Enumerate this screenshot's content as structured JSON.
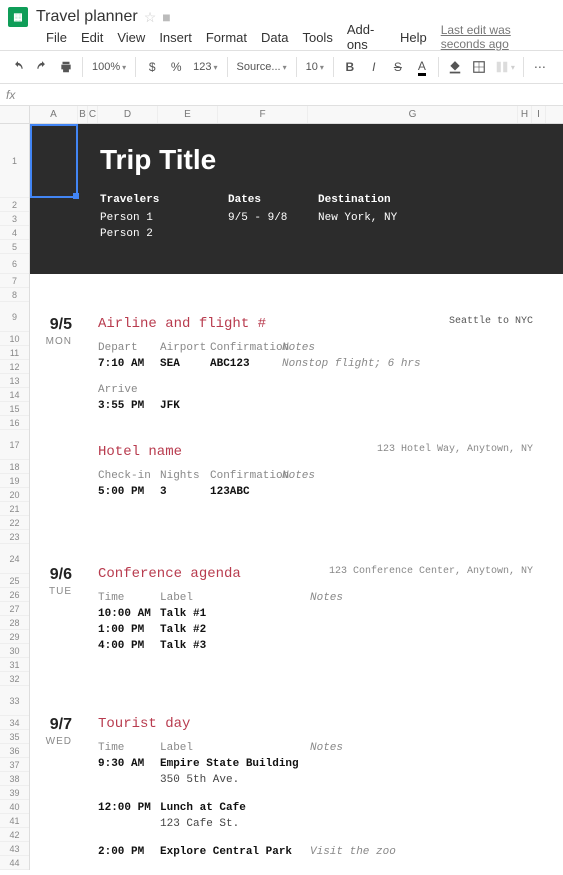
{
  "doc": {
    "title": "Travel planner",
    "last_edit": "Last edit was seconds ago"
  },
  "menu": {
    "file": "File",
    "edit": "Edit",
    "view": "View",
    "insert": "Insert",
    "format": "Format",
    "data": "Data",
    "tools": "Tools",
    "addons": "Add-ons",
    "help": "Help"
  },
  "toolbar": {
    "zoom": "100%",
    "currency": "$",
    "percent": "%",
    "dec": "123",
    "font": "Source...",
    "size": "10"
  },
  "cols": {
    "A": "A",
    "B": "B",
    "C": "C",
    "D": "D",
    "E": "E",
    "F": "F",
    "G": "G",
    "H": "H",
    "I": "I"
  },
  "hero": {
    "title": "Trip Title",
    "travelers_lbl": "Travelers",
    "traveler1": "Person 1",
    "traveler2": "Person 2",
    "dates_lbl": "Dates",
    "dates_val": "9/5 - 9/8",
    "dest_lbl": "Destination",
    "dest_val": "New York, NY"
  },
  "day1": {
    "date": "9/5",
    "dow": "MON",
    "flight": {
      "title": "Airline and flight #",
      "loc": "Seattle to NYC",
      "hdr_depart": "Depart",
      "hdr_airport": "Airport",
      "hdr_conf": "Confirmation",
      "hdr_notes": "Notes",
      "dep_time": "7:10 AM",
      "dep_air": "SEA",
      "conf": "ABC123",
      "notes": "Nonstop flight; 6 hrs",
      "hdr_arrive": "Arrive",
      "arr_time": "3:55 PM",
      "arr_air": "JFK"
    },
    "hotel": {
      "title": "Hotel name",
      "loc": "123 Hotel Way, Anytown, NY",
      "hdr_checkin": "Check-in",
      "hdr_nights": "Nights",
      "hdr_conf": "Confirmation",
      "hdr_notes": "Notes",
      "checkin": "5:00 PM",
      "nights": "3",
      "conf": "123ABC"
    }
  },
  "day2": {
    "date": "9/6",
    "dow": "TUE",
    "conf": {
      "title": "Conference agenda",
      "loc": "123 Conference Center, Anytown, NY",
      "hdr_time": "Time",
      "hdr_label": "Label",
      "hdr_notes": "Notes",
      "r1t": "10:00 AM",
      "r1l": "Talk #1",
      "r2t": "1:00 PM",
      "r2l": "Talk #2",
      "r3t": "4:00 PM",
      "r3l": "Talk #3"
    }
  },
  "day3": {
    "date": "9/7",
    "dow": "WED",
    "tour": {
      "title": "Tourist day",
      "hdr_time": "Time",
      "hdr_label": "Label",
      "hdr_notes": "Notes",
      "r1t": "9:30 AM",
      "r1l": "Empire State Building",
      "r1s": "350 5th Ave.",
      "r2t": "12:00 PM",
      "r2l": "Lunch at Cafe",
      "r2s": "123 Cafe St.",
      "r3t": "2:00 PM",
      "r3l": "Explore Central Park",
      "r3n": "Visit the zoo"
    }
  },
  "rows": [
    74,
    14,
    14,
    14,
    14,
    20,
    14,
    14,
    30,
    14,
    14,
    14,
    14,
    14,
    14,
    14,
    30,
    14,
    14,
    14,
    14,
    14,
    14,
    30,
    14,
    14,
    14,
    14,
    14,
    14,
    14,
    14,
    30,
    14,
    14,
    14,
    14,
    14,
    14,
    14,
    14,
    14,
    14,
    14
  ]
}
